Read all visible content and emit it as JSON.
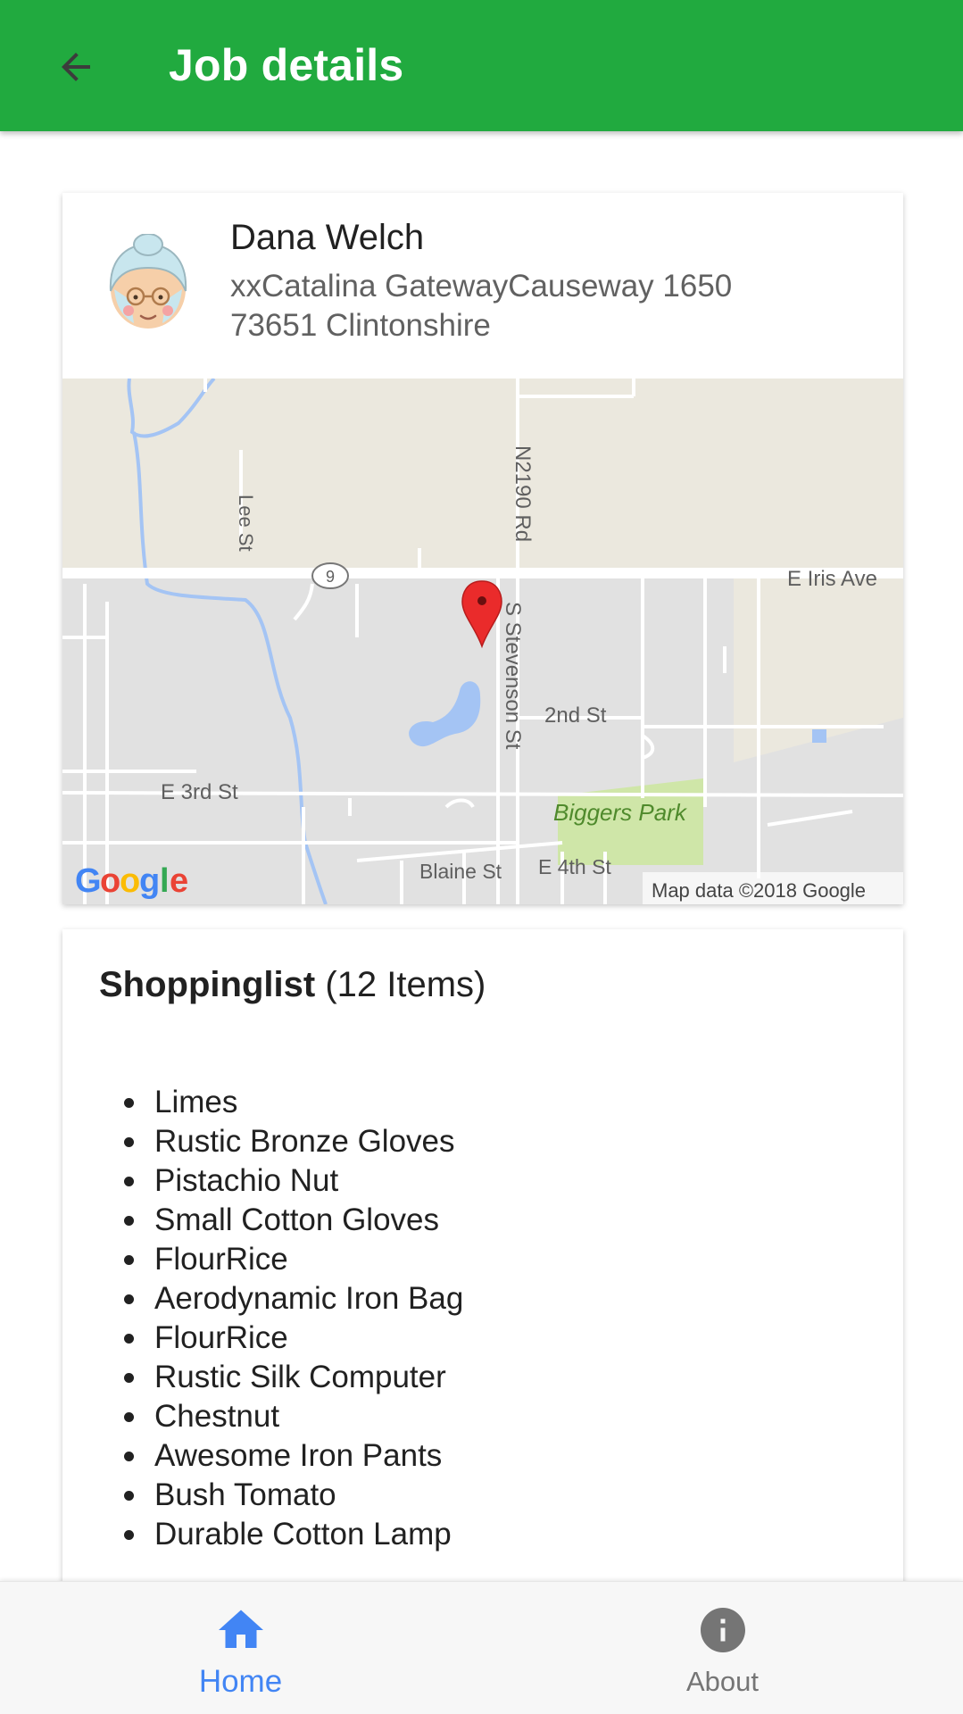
{
  "colors": {
    "primary": "#21aa3f",
    "accent": "#4285f4",
    "inactive": "#757575"
  },
  "appbar": {
    "back_icon": "arrow-back-icon",
    "title": "Job details"
  },
  "job": {
    "avatar_icon": "grandma-avatar-icon",
    "name": "Dana Welch",
    "address_line1": "xxCatalina GatewayCauseway 1650",
    "address_line2": "73651 Clintonshire"
  },
  "map": {
    "labels": {
      "lee_st": "Lee St",
      "n2190": "N2190 Rd",
      "route": "9",
      "e_iris": "E Iris Ave",
      "s_stevenson": "S Stevenson St",
      "second_st": "2nd St",
      "e_3rd": "E 3rd St",
      "biggers_park": "Biggers Park",
      "blaine": "Blaine St",
      "e_4th": "E 4th St",
      "attribution": "Map data ©2018 Google"
    },
    "logo_letters": [
      "G",
      "o",
      "o",
      "g",
      "l",
      "e"
    ],
    "marker_icon": "map-pin-icon"
  },
  "shopping": {
    "title_bold": "Shoppinglist",
    "count": "(12 Items)",
    "items": [
      "Limes",
      "Rustic Bronze Gloves",
      "Pistachio Nut",
      "Small Cotton Gloves",
      "FlourRice",
      "Aerodynamic Iron Bag",
      "FlourRice",
      "Rustic Silk Computer",
      "Chestnut",
      "Awesome Iron Pants",
      "Bush Tomato",
      "Durable Cotton Lamp"
    ]
  },
  "nav": {
    "home": {
      "label": "Home",
      "icon": "home-icon"
    },
    "about": {
      "label": "About",
      "icon": "info-icon"
    }
  }
}
